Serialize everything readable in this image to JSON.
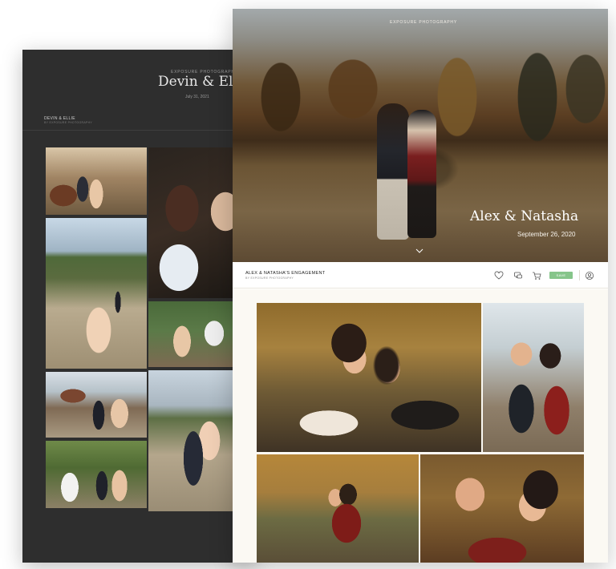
{
  "back_gallery": {
    "brand": "EXPOSURE PHOTOGRAPHY",
    "title": "Devin & Ellie",
    "date": "July 31, 2021",
    "nav_title": "DEVIN & ELLIE",
    "nav_subtitle": "BY EXPOSURE PHOTOGRAPHY"
  },
  "front_gallery": {
    "hero": {
      "brand": "EXPOSURE PHOTOGRAPHY",
      "title": "Alex & Natasha",
      "date": "September 26, 2020"
    },
    "toolbar": {
      "title": "ALEX & NATASHA'S ENGAGEMENT",
      "subtitle": "BY EXPOSURE PHOTOGRAPHY",
      "button_label": "SAVE",
      "button_color": "#86c58a"
    }
  },
  "icons": {
    "favorite": "heart-icon",
    "comment": "chat-icon",
    "cart": "cart-icon",
    "account": "user-icon",
    "scroll": "chevron-down-icon"
  }
}
